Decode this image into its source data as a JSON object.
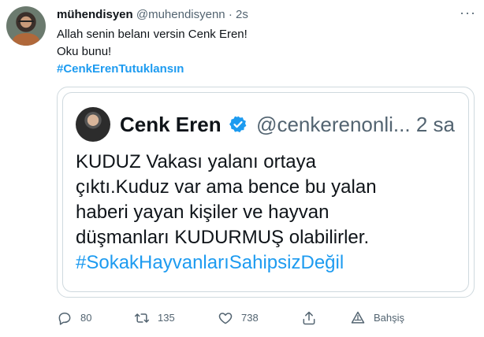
{
  "tweet": {
    "author_name": "mühendisyen",
    "author_handle": "@muhendisyenn",
    "separator": "·",
    "time": "2s",
    "lines": [
      "Allah senin belanı versin Cenk Eren!",
      "Oku bunu!"
    ],
    "hashtag": "#CenkErenTutuklansın",
    "more_label": "···"
  },
  "quoted_tweet": {
    "author_name": "Cenk Eren",
    "author_handle": "@cenkerenonli...",
    "time": "2 sa",
    "lines": [
      "KUDUZ Vakası yalanı ortaya",
      "çıktı.Kuduz var ama bence bu yalan",
      "haberi yayan kişiler ve hayvan",
      "düşmanları KUDURMUŞ olabilirler."
    ],
    "hashtag": "#SokakHayvanlarıSahipsizDeğil"
  },
  "actions": {
    "reply_count": "80",
    "retweet_count": "135",
    "like_count": "738",
    "tip_label": "Bahşiş"
  },
  "colors": {
    "link": "#1d9bf0",
    "muted": "#536471",
    "border": "#cfd9de"
  },
  "icons": [
    "reply-icon",
    "retweet-icon",
    "like-icon",
    "share-icon",
    "tip-icon",
    "verified-badge-icon",
    "more-icon"
  ]
}
